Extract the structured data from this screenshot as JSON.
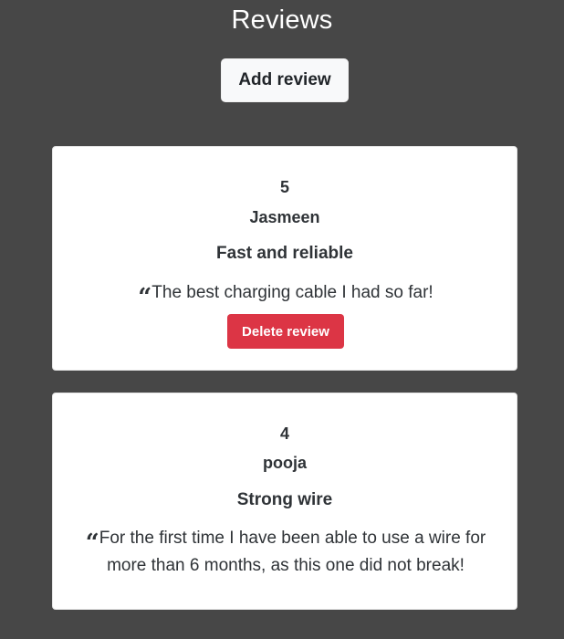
{
  "page": {
    "title": "Reviews",
    "add_button_label": "Add review"
  },
  "reviews": [
    {
      "rating": "5",
      "author": "Jasmeen",
      "headline": "Fast and reliable",
      "quote_icon": "quote-left-icon",
      "text": "The best charging cable I had so far!",
      "delete_label": "Delete review"
    },
    {
      "rating": "4",
      "author": "pooja",
      "headline": "Strong wire",
      "quote_icon": "quote-left-icon",
      "text": "For the first time I have been able to use a wire for more than 6 months, as this one did not break!"
    }
  ],
  "colors": {
    "background": "#474747",
    "card": "#ffffff",
    "delete_button": "#dc3545",
    "add_button": "#f8f9fa",
    "text": "#2f3337"
  }
}
